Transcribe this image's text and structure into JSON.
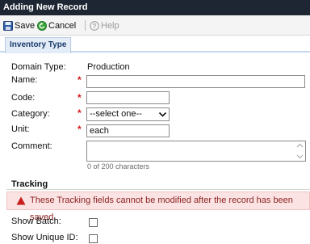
{
  "window": {
    "title": "Adding New Record"
  },
  "toolbar": {
    "save_label": "Save",
    "cancel_label": "Cancel",
    "help_label": "Help"
  },
  "tabs": [
    {
      "label": "Inventory Type",
      "active": true
    }
  ],
  "form": {
    "domain_type": {
      "label": "Domain Type:",
      "value": "Production"
    },
    "name": {
      "label": "Name:",
      "value": "",
      "required": true
    },
    "code": {
      "label": "Code:",
      "value": "",
      "required": true
    },
    "category": {
      "label": "Category:",
      "selected": "--select one--",
      "required": true
    },
    "unit": {
      "label": "Unit:",
      "value": "each",
      "required": true
    },
    "comment": {
      "label": "Comment:",
      "value": "",
      "char_count": "0 of 200 characters"
    },
    "required_marker": "*"
  },
  "tracking": {
    "heading": "Tracking",
    "warning": "These Tracking fields cannot be modified after the record has been saved.",
    "show_batch": {
      "label": "Show Batch:",
      "checked": false
    },
    "show_unique_id": {
      "label": "Show Unique ID:",
      "checked": false
    }
  },
  "colors": {
    "title_bar": "#1f2633",
    "required": "#d4191c",
    "warning_bg": "#fbe3e3",
    "warning_text": "#8a1e1e",
    "tab_bg": "#e3ecf7"
  },
  "icons": {
    "save": "floppy-disk-icon",
    "cancel": "green-circle-arrow-icon",
    "help": "question-circle-icon",
    "warning": "warning-triangle-icon",
    "dropdown": "chevron-down-icon"
  }
}
